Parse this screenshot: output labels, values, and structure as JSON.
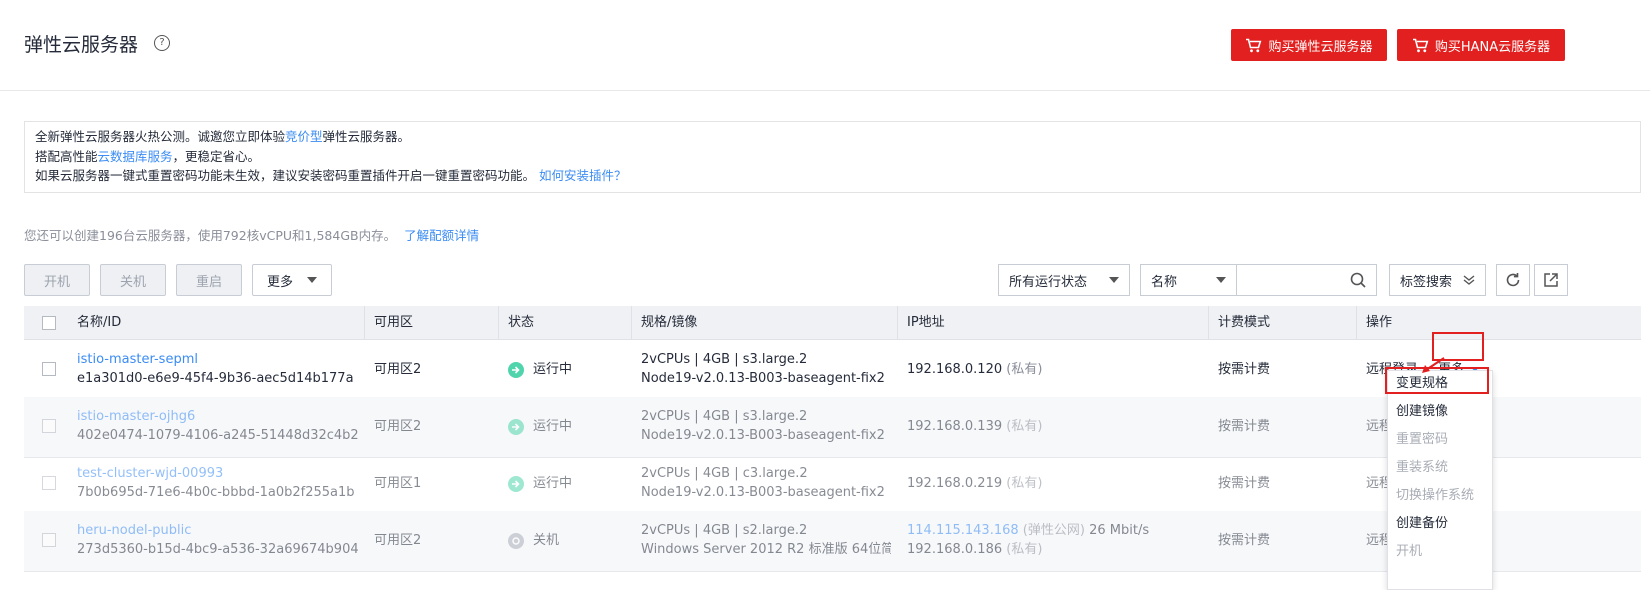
{
  "page": {
    "title": "弹性云服务器",
    "help_icon": "?",
    "buy_ecs": "购买弹性云服务器",
    "buy_hana": "购买HANA云服务器"
  },
  "notice": {
    "line1_pre": "全新弹性云服务器火热公测。诚邀您立即体验",
    "line1_link": "竞价型",
    "line1_post": "弹性云服务器。",
    "line2_pre": "搭配高性能",
    "line2_link": "云数据库服务",
    "line2_post": "，更稳定省心。",
    "line3_pre": "如果云服务器一键式重置密码功能未生效，建议安装密码重置插件开启一键重置密码功能。",
    "line3_link": "如何安装插件？"
  },
  "quota": {
    "text": "您还可以创建196台云服务器，使用792核vCPU和1,584GB内存。",
    "link": "了解配额详情"
  },
  "toolbar": {
    "start": "开机",
    "stop": "关机",
    "restart": "重启",
    "more": "更多",
    "status_filter": "所有运行状态",
    "search_field": "名称",
    "search_value": "",
    "tag_search": "标签搜索"
  },
  "table": {
    "headers": [
      "名称/ID",
      "可用区",
      "状态",
      "规格/镜像",
      "IP地址",
      "计费模式",
      "操作"
    ],
    "rows": [
      {
        "name": "istio-master-sepml",
        "id": "e1a301d0-e6e9-45f4-9b36-aec5d14b177a",
        "az": "可用区2",
        "status": "运行中",
        "spec": "2vCPUs | 4GB | s3.large.2",
        "image": "Node19-v2.0.13-B003-baseagent-fix2",
        "ip": "192.168.0.120",
        "ip_type": "(私有)",
        "billing": "按需计费",
        "op_login": "远程登录",
        "op_more": "更多"
      },
      {
        "name": "istio-master-ojhg6",
        "id": "402e0474-1079-4106-a245-51448d32c4b2",
        "az": "可用区2",
        "status": "运行中",
        "spec": "2vCPUs | 4GB | s3.large.2",
        "image": "Node19-v2.0.13-B003-baseagent-fix2",
        "ip": "192.168.0.139",
        "ip_type": "(私有)",
        "billing": "按需计费",
        "op_login": "远程"
      },
      {
        "name": "test-cluster-wjd-00993",
        "id": "7b0b695d-71e6-4b0c-bbbd-1a0b2f255a1b",
        "az": "可用区1",
        "status": "运行中",
        "spec": "2vCPUs | 4GB | c3.large.2",
        "image": "Node19-v2.0.13-B003-baseagent-fix2",
        "ip": "192.168.0.219",
        "ip_type": "(私有)",
        "billing": "按需计费",
        "op_login": "远程"
      },
      {
        "name": "heru-nodel-public",
        "id": "273d5360-b15d-4bc9-a536-32a69674b904",
        "az": "可用区2",
        "status": "关机",
        "spec": "2vCPUs | 4GB | s2.large.2",
        "image": "Windows Server 2012 R2 标准版 64位简...",
        "ip_public": "114.115.143.168",
        "ip_public_type": "(弹性公网)",
        "bandwidth": "26 Mbit/s",
        "ip": "192.168.0.186",
        "ip_type": "(私有)",
        "billing": "按需计费",
        "op_login": "远程"
      }
    ]
  },
  "more_menu": {
    "items": [
      {
        "label": "变更规格",
        "enabled": true
      },
      {
        "label": "创建镜像",
        "enabled": true
      },
      {
        "label": "重置密码",
        "enabled": false
      },
      {
        "label": "重装系统",
        "enabled": false
      },
      {
        "label": "切换操作系统",
        "enabled": false
      },
      {
        "label": "创建备份",
        "enabled": true
      },
      {
        "label": "开机",
        "enabled": false
      }
    ]
  },
  "colors": {
    "brand_red": "#e1201f",
    "link_blue": "#3b8cf4",
    "running_green": "#50d4ab",
    "stopped_gray": "#a9aeb8"
  }
}
